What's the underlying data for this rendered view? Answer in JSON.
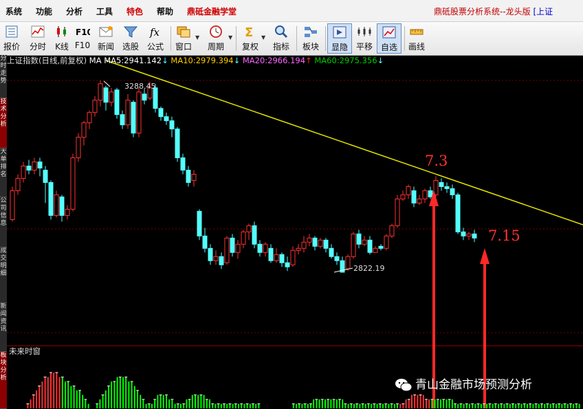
{
  "menu": [
    "系统",
    "功能",
    "分析",
    "工具",
    "特色",
    "帮助",
    "鼎砥金融学堂"
  ],
  "app_title": "鼎砥股票分析系统--龙头版",
  "app_title_suffix": "[上证",
  "toolbar": [
    {
      "label": "报价",
      "icon": "quote-list-icon"
    },
    {
      "label": "分时",
      "icon": "intraday-chart-icon"
    },
    {
      "label": "K线",
      "icon": "candlestick-icon"
    },
    {
      "label": "F10",
      "icon": "f10-icon"
    },
    {
      "label": "新闻",
      "icon": "news-icon"
    },
    {
      "label": "选股",
      "icon": "stock-filter-icon"
    },
    {
      "label": "公式",
      "icon": "formula-icon"
    },
    {
      "label": "窗口",
      "icon": "window-icon"
    },
    {
      "label": "周期",
      "icon": "period-clock-icon"
    },
    {
      "label": "复权",
      "icon": "sigma-icon"
    },
    {
      "label": "指标",
      "icon": "indicator-search-icon"
    },
    {
      "label": "板块",
      "icon": "sector-icon"
    },
    {
      "label": "显隐",
      "icon": "show-hide-icon"
    },
    {
      "label": "平移",
      "icon": "pan-icon"
    },
    {
      "label": "自选",
      "icon": "watchlist-icon"
    },
    {
      "label": "画线",
      "icon": "draw-line-icon"
    }
  ],
  "sidebar_tabs": [
    "分时走势",
    "技术分析",
    "大单排名",
    "公司信息",
    "成交明细",
    "新闻资讯",
    "板块分析"
  ],
  "chart_header": {
    "symbol": "上证指数",
    "period": "(日线,前复权)",
    "ma_prefix": "MA",
    "ma5": "MA5:2941.142",
    "ma10": "MA10:2979.394",
    "ma20": "MA20:2966.194",
    "ma60": "MA60:2975.356",
    "arrow_down": "↓",
    "arrow_up": "↑"
  },
  "colors": {
    "up": "#ff3232",
    "down": "#54ffff",
    "trendline": "#e6e600",
    "annotation": "#ff3232",
    "ma5": "#ffffff",
    "ma10": "#ffcc00",
    "ma20": "#ff66ff",
    "ma60": "#00cc00"
  },
  "chart_data": {
    "type": "candlestick",
    "price_high_label": "3288.45",
    "price_low_label": "2822.19",
    "candles": [
      [
        2950,
        3020,
        3030,
        2945
      ],
      [
        3020,
        3050,
        3060,
        3010
      ],
      [
        3050,
        3080,
        3090,
        3040
      ],
      [
        3080,
        3070,
        3095,
        3060
      ],
      [
        3070,
        3090,
        3100,
        3060
      ],
      [
        3090,
        3075,
        3100,
        3055
      ],
      [
        3070,
        3040,
        3080,
        2990
      ],
      [
        3040,
        2960,
        3045,
        2950
      ],
      [
        2960,
        3010,
        3020,
        2955
      ],
      [
        3005,
        2960,
        3010,
        2945
      ],
      [
        2960,
        2975,
        2985,
        2950
      ],
      [
        2975,
        3100,
        3110,
        2970
      ],
      [
        3100,
        3150,
        3160,
        3090
      ],
      [
        3150,
        3185,
        3190,
        3130
      ],
      [
        3185,
        3210,
        3215,
        3170
      ],
      [
        3210,
        3240,
        3250,
        3200
      ],
      [
        3240,
        3280,
        3288,
        3225
      ],
      [
        3270,
        3235,
        3275,
        3215
      ],
      [
        3235,
        3260,
        3270,
        3225
      ],
      [
        3265,
        3205,
        3270,
        3195
      ],
      [
        3205,
        3180,
        3215,
        3170
      ],
      [
        3180,
        3240,
        3255,
        3170
      ],
      [
        3235,
        3160,
        3240,
        3150
      ],
      [
        3160,
        3260,
        3270,
        3150
      ],
      [
        3255,
        3240,
        3268,
        3230
      ],
      [
        3245,
        3270,
        3285,
        3240
      ],
      [
        3270,
        3220,
        3280,
        3210
      ],
      [
        3220,
        3200,
        3225,
        3190
      ],
      [
        3200,
        3190,
        3210,
        3180
      ],
      [
        3190,
        3170,
        3200,
        3150
      ],
      [
        3170,
        3100,
        3175,
        3090
      ],
      [
        3100,
        3070,
        3110,
        3060
      ],
      [
        3070,
        3040,
        3080,
        3030
      ],
      [
        3045,
        3060,
        3070,
        3030
      ],
      [
        2970,
        2910,
        2975,
        2900
      ],
      [
        2910,
        2880,
        2930,
        2870
      ],
      [
        2880,
        2850,
        2890,
        2840
      ],
      [
        2850,
        2860,
        2875,
        2840
      ],
      [
        2860,
        2840,
        2870,
        2830
      ],
      [
        2845,
        2905,
        2910,
        2840
      ],
      [
        2905,
        2870,
        2915,
        2860
      ],
      [
        2870,
        2890,
        2900,
        2855
      ],
      [
        2890,
        2920,
        2925,
        2880
      ],
      [
        2920,
        2935,
        2940,
        2900
      ],
      [
        2935,
        2890,
        2945,
        2880
      ],
      [
        2890,
        2870,
        2900,
        2860
      ],
      [
        2870,
        2890,
        2895,
        2860
      ],
      [
        2880,
        2850,
        2890,
        2845
      ],
      [
        2850,
        2865,
        2880,
        2845
      ],
      [
        2865,
        2845,
        2870,
        2835
      ],
      [
        2845,
        2835,
        2860,
        2825
      ],
      [
        2840,
        2875,
        2885,
        2835
      ],
      [
        2875,
        2880,
        2890,
        2865
      ],
      [
        2880,
        2895,
        2910,
        2870
      ],
      [
        2895,
        2905,
        2915,
        2885
      ],
      [
        2905,
        2885,
        2910,
        2875
      ],
      [
        2885,
        2900,
        2905,
        2880
      ],
      [
        2900,
        2880,
        2905,
        2870
      ],
      [
        2880,
        2860,
        2890,
        2855
      ],
      [
        2860,
        2850,
        2870,
        2840
      ],
      [
        2850,
        2822,
        2860,
        2822
      ],
      [
        2830,
        2860,
        2865,
        2825
      ],
      [
        2860,
        2915,
        2920,
        2855
      ],
      [
        2915,
        2890,
        2925,
        2880
      ],
      [
        2890,
        2900,
        2910,
        2885
      ],
      [
        2900,
        2870,
        2910,
        2865
      ],
      [
        2870,
        2880,
        2885,
        2870
      ],
      [
        2885,
        2880,
        2890,
        2875
      ],
      [
        2880,
        2910,
        2915,
        2875
      ],
      [
        2910,
        2935,
        2940,
        2905
      ],
      [
        2935,
        3000,
        3010,
        2930
      ],
      [
        3000,
        3010,
        3020,
        2995
      ],
      [
        3010,
        3030,
        3035,
        3000
      ],
      [
        3020,
        2990,
        3030,
        2980
      ],
      [
        2990,
        3000,
        3010,
        2985
      ],
      [
        3000,
        3020,
        3025,
        2990
      ],
      [
        3020,
        3005,
        3030,
        3000
      ],
      [
        3010,
        3045,
        3055,
        3005
      ],
      [
        3040,
        3030,
        3050,
        3020
      ],
      [
        3030,
        3025,
        3040,
        3015
      ],
      [
        3025,
        3010,
        3035,
        3000
      ],
      [
        3010,
        2920,
        3015,
        2915
      ],
      [
        2920,
        2910,
        2930,
        2900
      ],
      [
        2910,
        2915,
        2920,
        2900
      ],
      [
        2915,
        2905,
        2925,
        2895
      ]
    ],
    "annotations": [
      "7.3",
      "7.15"
    ],
    "sub_window_label": "未来时窗",
    "sub_window_bars": [
      0,
      0,
      1,
      2,
      3,
      4,
      5,
      6,
      7,
      7,
      8,
      8,
      8,
      7,
      7,
      6,
      6,
      5,
      5,
      4,
      4,
      3,
      2,
      1,
      0,
      0,
      1,
      2,
      3,
      4,
      5,
      6,
      6,
      7,
      7,
      7,
      7,
      6,
      6,
      5,
      4,
      3,
      2,
      1,
      1,
      1,
      2,
      3,
      3,
      3,
      3,
      2,
      2,
      1,
      1,
      1,
      1,
      2,
      2,
      3,
      3,
      3,
      3,
      3,
      2,
      2,
      1,
      1,
      1,
      1,
      1,
      1,
      1,
      1,
      1,
      1,
      1,
      1,
      1,
      1,
      1,
      1,
      1,
      0,
      0,
      0,
      0,
      0,
      0,
      0,
      0,
      0,
      0,
      0,
      1,
      1,
      1,
      1,
      1,
      1,
      1,
      2,
      2,
      2,
      2,
      2,
      2,
      2,
      2,
      2,
      2,
      2,
      1,
      1,
      1,
      1,
      1,
      1,
      1,
      1,
      1,
      1,
      1,
      1,
      1,
      1,
      1,
      1,
      1,
      1,
      1,
      1,
      1,
      2,
      2,
      3,
      3,
      3,
      3,
      3,
      2,
      2,
      2,
      2,
      2,
      2,
      2,
      2,
      2,
      2,
      1,
      1,
      1,
      1,
      1,
      1,
      1,
      1,
      1,
      1,
      1,
      1,
      1,
      1,
      1,
      1,
      1,
      1,
      1,
      1,
      1,
      1,
      1,
      1,
      1,
      1,
      1,
      1,
      1,
      1,
      1,
      1,
      1,
      1,
      1,
      1,
      1,
      1,
      1,
      1,
      1,
      1,
      1,
      1,
      1,
      1,
      1
    ]
  },
  "watermark": "青山金融市场预测分析"
}
